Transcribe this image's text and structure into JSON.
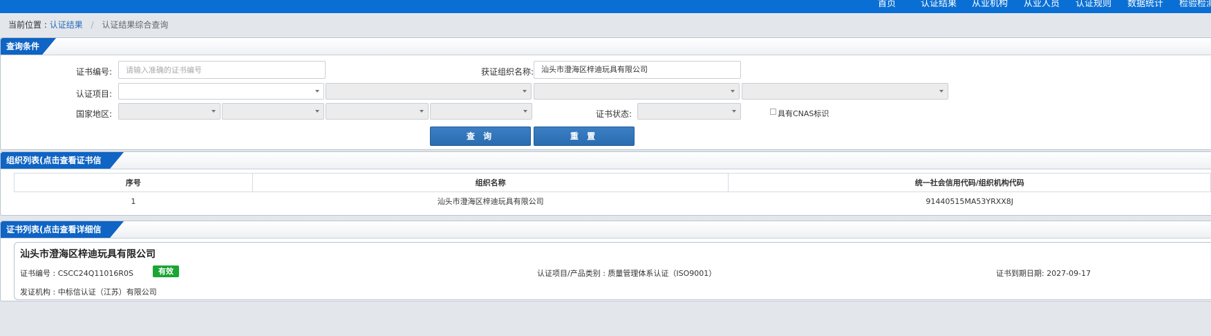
{
  "nav": {
    "items": [
      "首页",
      "认证结果",
      "从业机构",
      "从业人员",
      "认证规则",
      "数据统计",
      "检验检测"
    ]
  },
  "breadcrumb": {
    "prefix": "当前位置 :",
    "link": "认证结果",
    "separator": "/",
    "current": "认证结果综合查询"
  },
  "query": {
    "tab": "查询条件",
    "cert_no_label": "证书编号:",
    "cert_no_placeholder": "请输入准确的证书编号",
    "cert_no_value": "",
    "org_name_label": "获证组织名称:",
    "org_name_value": "汕头市澄海区梓迪玩具有限公司",
    "project_label": "认证项目:",
    "region_label": "国家地区:",
    "status_label": "证书状态:",
    "cnas_label": "具有CNAS标识",
    "search_button": "查 询",
    "reset_button": "重 置"
  },
  "org_list": {
    "tab": "组织列表(点击查看证书信息)",
    "headers": [
      "序号",
      "组织名称",
      "统一社会信用代码/组织机构代码"
    ],
    "rows": [
      [
        "1",
        "汕头市澄海区梓迪玩具有限公司",
        "91440515MA53YRXX8J"
      ]
    ]
  },
  "cert_list": {
    "tab": "证书列表(点击查看详细信息)",
    "org_name": "汕头市澄海区梓迪玩具有限公司",
    "cert_no": "证书编号 : CSCC24Q11016R0S",
    "status": "有效",
    "project": "认证项目/产品类别 : 质量管理体系认证（ISO9001）",
    "expiry": "证书到期日期: 2027-09-17",
    "issuer": "发证机构 : 中标信认证（江苏）有限公司"
  },
  "colors": {
    "topbar": "#0a6fd4",
    "tab": "#0f64c4",
    "button": "#2b6db0",
    "badge": "#1aa534",
    "background": "#e3e7ec"
  }
}
